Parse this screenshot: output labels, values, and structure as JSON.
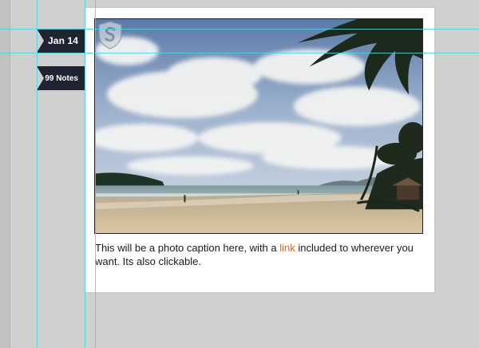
{
  "post": {
    "date": "Jan 14",
    "notes": "99 Notes",
    "caption_before": "This will be a photo caption here, with a ",
    "caption_link": "link",
    "caption_after": " included to wherever you want. Its also clickable."
  },
  "colors": {
    "background": "#cfcfcf",
    "flag": "#1f2433",
    "link": "#d86a1c",
    "guide": "#46d7e1"
  },
  "icons": {
    "logo": "shield-s-logo-icon"
  }
}
